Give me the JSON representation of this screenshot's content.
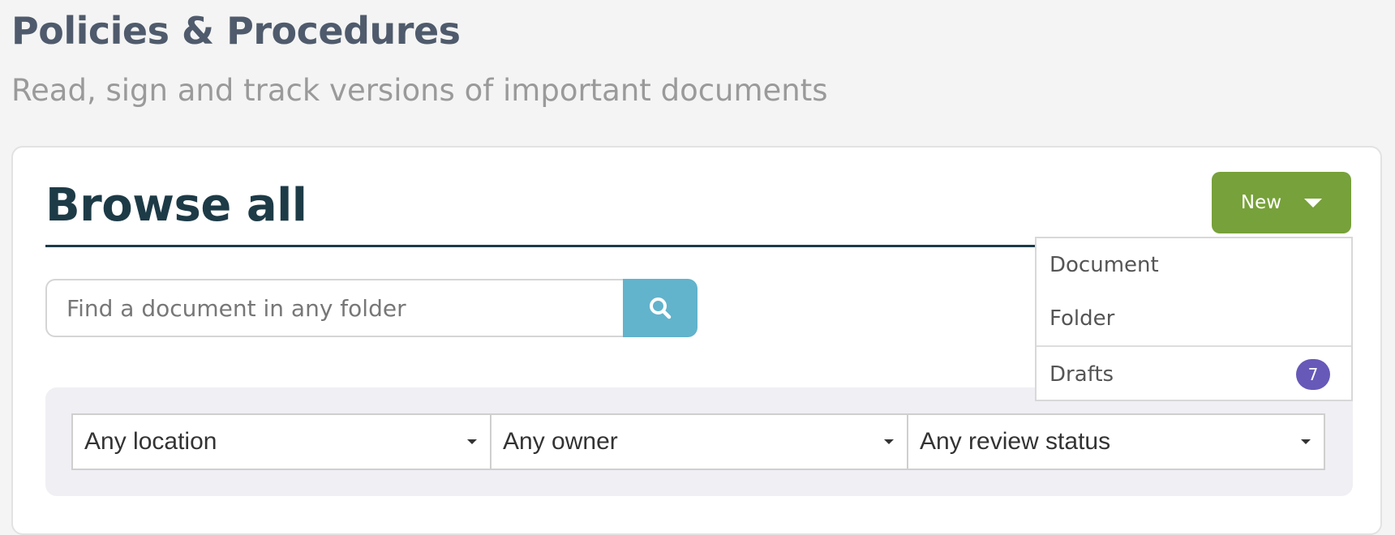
{
  "header": {
    "title": "Policies & Procedures",
    "subtitle": "Read, sign and track versions of important documents"
  },
  "card": {
    "title": "Browse all",
    "new_button": {
      "label": "New"
    },
    "new_menu": {
      "items": [
        "Document",
        "Folder"
      ],
      "drafts": {
        "label": "Drafts",
        "count": "7"
      }
    },
    "search": {
      "placeholder": "Find a document in any folder",
      "value": ""
    },
    "filters": [
      "Any location",
      "Any owner",
      "Any review status"
    ]
  },
  "colors": {
    "accent_green": "#77a13a",
    "search_blue": "#62b3cc",
    "badge_purple": "#6659b8",
    "heading_dark": "#1d3b47"
  },
  "icons": {
    "search_button": "search-icon",
    "new_button": "caret-down-icon",
    "filter_select": "caret-down-icon"
  }
}
